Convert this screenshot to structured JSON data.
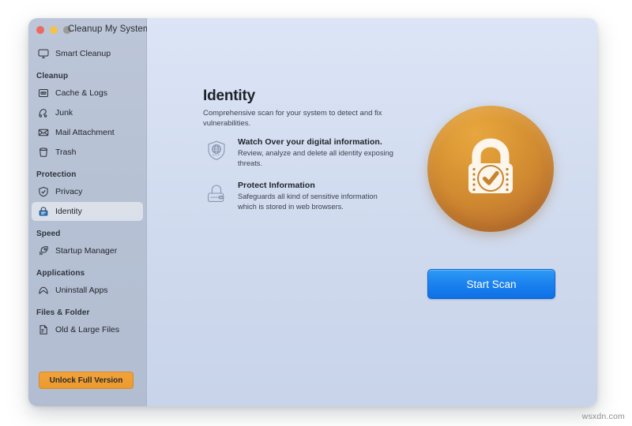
{
  "window": {
    "title": "Cleanup My System",
    "traffic_lights": [
      {
        "name": "close",
        "color": "#ec6a5f"
      },
      {
        "name": "minimize",
        "color": "#f4c04e"
      },
      {
        "name": "zoom",
        "color": "#9a9a9a"
      }
    ]
  },
  "sidebar": {
    "top_items": [
      {
        "label": "Smart Cleanup",
        "icon": "monitor-icon",
        "selected": false
      }
    ],
    "groups": [
      {
        "label": "Cleanup",
        "items": [
          {
            "label": "Cache & Logs",
            "icon": "log-file-icon",
            "selected": false
          },
          {
            "label": "Junk",
            "icon": "junk-icon",
            "selected": false
          },
          {
            "label": "Mail Attachment",
            "icon": "envelope-icon",
            "selected": false
          },
          {
            "label": "Trash",
            "icon": "trash-icon",
            "selected": false
          }
        ]
      },
      {
        "label": "Protection",
        "items": [
          {
            "label": "Privacy",
            "icon": "shield-check-icon",
            "selected": false
          },
          {
            "label": "Identity",
            "icon": "lock-icon",
            "selected": true
          }
        ]
      },
      {
        "label": "Speed",
        "items": [
          {
            "label": "Startup Manager",
            "icon": "rocket-icon",
            "selected": false
          }
        ]
      },
      {
        "label": "Applications",
        "items": [
          {
            "label": "Uninstall Apps",
            "icon": "app-arch-icon",
            "selected": false
          }
        ]
      },
      {
        "label": "Files & Folder",
        "items": [
          {
            "label": "Old & Large Files",
            "icon": "document-icon",
            "selected": false
          }
        ]
      }
    ],
    "unlock_button": "Unlock Full Version",
    "colors": {
      "background": "#b6c1d4",
      "selected_row": "#e9ecf1",
      "unlock_button": "#eb9a2e"
    }
  },
  "main": {
    "title": "Identity",
    "subtitle": "Comprehensive scan for your system to detect and fix vulnerabilities.",
    "features": [
      {
        "icon": "shield-globe-icon",
        "title": "Watch Over your digital information.",
        "description": "Review, analyze and delete all identity exposing threats."
      },
      {
        "icon": "padlock-eye-icon",
        "title": "Protect Information",
        "description": "Safeguards all kind of sensitive information which is stored in web browsers."
      }
    ],
    "hero_badge": {
      "icon": "lock-check-badge-icon",
      "color_top": "#e8a63f",
      "color_bottom": "#a5632d"
    },
    "scan_button": {
      "label": "Start Scan",
      "color": "#1b82ef"
    },
    "background_color": "#d3ddf0"
  },
  "watermark": "wsxdn.com"
}
